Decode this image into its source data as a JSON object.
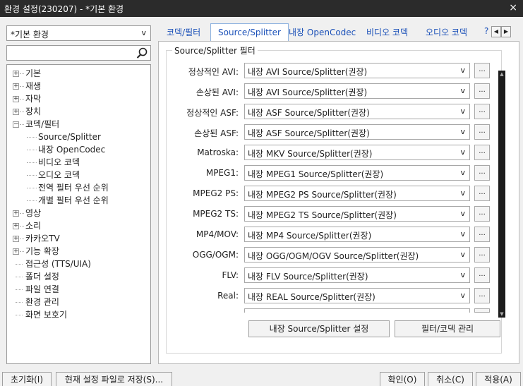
{
  "window": {
    "title": "환경 설정(230207) - *기본 환경",
    "close": "×"
  },
  "preset": {
    "value": "*기본 환경",
    "arrow": "v"
  },
  "tree": [
    {
      "label": "기본",
      "level": 0,
      "toggle": "+"
    },
    {
      "label": "재생",
      "level": 0,
      "toggle": "+"
    },
    {
      "label": "자막",
      "level": 0,
      "toggle": "+"
    },
    {
      "label": "장치",
      "level": 0,
      "toggle": "+"
    },
    {
      "label": "코덱/필터",
      "level": 0,
      "toggle": "−"
    },
    {
      "label": "Source/Splitter",
      "level": 1,
      "toggle": ""
    },
    {
      "label": "내장 OpenCodec",
      "level": 1,
      "toggle": ""
    },
    {
      "label": "비디오 코덱",
      "level": 1,
      "toggle": ""
    },
    {
      "label": "오디오 코덱",
      "level": 1,
      "toggle": ""
    },
    {
      "label": "전역 필터 우선 순위",
      "level": 1,
      "toggle": ""
    },
    {
      "label": "개별 필터 우선 순위",
      "level": 1,
      "toggle": ""
    },
    {
      "label": "영상",
      "level": 0,
      "toggle": "+"
    },
    {
      "label": "소리",
      "level": 0,
      "toggle": "+"
    },
    {
      "label": "카카오TV",
      "level": 0,
      "toggle": "+"
    },
    {
      "label": "기능 확장",
      "level": 0,
      "toggle": "+"
    },
    {
      "label": "접근성 (TTS/UIA)",
      "level": 0,
      "toggle": ""
    },
    {
      "label": "폴더 설정",
      "level": 0,
      "toggle": ""
    },
    {
      "label": "파일 연결",
      "level": 0,
      "toggle": ""
    },
    {
      "label": "환경 관리",
      "level": 0,
      "toggle": ""
    },
    {
      "label": "화면 보호기",
      "level": 0,
      "toggle": ""
    }
  ],
  "tabs": [
    "코덱/필터",
    "Source/Splitter",
    "내장 OpenCodec",
    "비디오 코덱",
    "오디오 코덱",
    "?"
  ],
  "tab_nav": {
    "prev": "◀",
    "next": "▶"
  },
  "group_title": "Source/Splitter 필터",
  "rows": [
    {
      "label": "정상적인 AVI:",
      "value": "내장 AVI Source/Splitter(권장)"
    },
    {
      "label": "손상된 AVI:",
      "value": "내장 AVI Source/Splitter(권장)"
    },
    {
      "label": "정상적인 ASF:",
      "value": "내장 ASF Source/Splitter(권장)"
    },
    {
      "label": "손상된 ASF:",
      "value": "내장 ASF Source/Splitter(권장)"
    },
    {
      "label": "Matroska:",
      "value": "내장 MKV Source/Splitter(권장)"
    },
    {
      "label": "MPEG1:",
      "value": "내장 MPEG1 Source/Splitter(권장)"
    },
    {
      "label": "MPEG2 PS:",
      "value": "내장 MPEG2 PS Source/Splitter(권장)"
    },
    {
      "label": "MPEG2 TS:",
      "value": "내장 MPEG2 TS Source/Splitter(권장)"
    },
    {
      "label": "MP4/MOV:",
      "value": "내장 MP4 Source/Splitter(권장)"
    },
    {
      "label": "OGG/OGM:",
      "value": "내장 OGG/OGM/OGV Source/Splitter(권장)"
    },
    {
      "label": "FLV:",
      "value": "내장 FLV Source/Splitter(권장)"
    },
    {
      "label": "Real:",
      "value": "내장 REAL Source/Splitter(권장)"
    }
  ],
  "select_arrow": "v",
  "more_label": "...",
  "scroll": {
    "up": "▲",
    "down": "▼"
  },
  "panel_buttons": {
    "settings": "내장 Source/Splitter 설정",
    "manage": "필터/코덱 관리"
  },
  "footer": {
    "reset": "초기화(I)",
    "save_current": "현재 설정 파일로 저장(S)...",
    "ok": "확인(O)",
    "cancel": "취소(C)",
    "apply": "적용(A)"
  }
}
